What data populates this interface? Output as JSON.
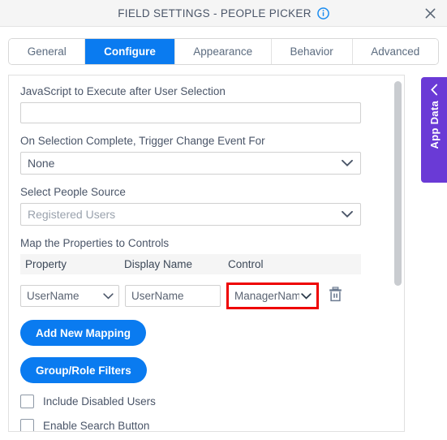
{
  "window": {
    "title": "FIELD SETTINGS - PEOPLE PICKER",
    "info_icon": "info-circle-icon",
    "close_icon": "close-icon"
  },
  "tabs": [
    {
      "label": "General",
      "active": false
    },
    {
      "label": "Configure",
      "active": true
    },
    {
      "label": "Appearance",
      "active": false
    },
    {
      "label": "Behavior",
      "active": false
    },
    {
      "label": "Advanced",
      "active": false
    }
  ],
  "form": {
    "javascript_label": "JavaScript to Execute after User Selection",
    "javascript_value": "",
    "javascript_placeholder": "",
    "trigger_label": "On Selection Complete, Trigger Change Event For",
    "trigger_value": "None",
    "people_source_label": "Select People Source",
    "people_source_value": "Registered Users",
    "mapping_label": "Map the Properties to Controls"
  },
  "mapping_table": {
    "columns": [
      "Property",
      "Display Name",
      "Control"
    ],
    "rows": [
      {
        "property": "UserName",
        "display_name": "UserName",
        "control": "ManagerName",
        "control_highlighted": true,
        "delete_icon": "trash-icon"
      }
    ]
  },
  "buttons": {
    "add_new_mapping": "Add New Mapping",
    "group_role_filters": "Group/Role Filters"
  },
  "checkboxes": [
    {
      "label": "Include Disabled Users",
      "checked": false
    },
    {
      "label": "Enable Search Button",
      "checked": false
    }
  ],
  "side_panel": {
    "label": "App Data",
    "chevron_icon": "chevron-left-icon",
    "color": "#6a3ad6"
  },
  "colors": {
    "accent": "#0a7bf0",
    "highlight": "#ee0000",
    "titlebar": "#f5f5f5"
  }
}
